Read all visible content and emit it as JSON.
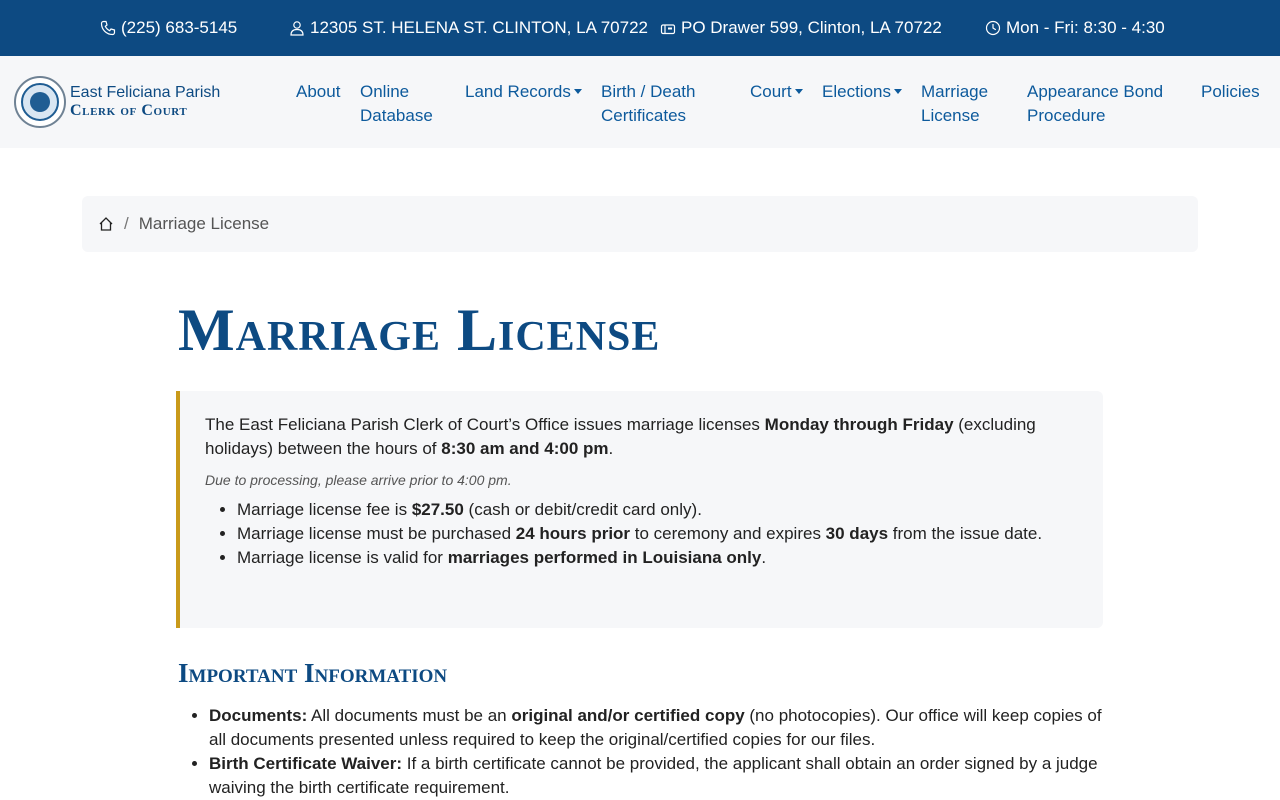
{
  "topbar": {
    "phone": "(225) 683-5145",
    "address": "12305 ST. HELENA ST. CLINTON, LA 70722",
    "mailing": "PO Drawer 599, Clinton, LA 70722",
    "hours": "Mon - Fri: 8:30 - 4:30",
    "colors": {
      "background": "#0d4a82"
    }
  },
  "brand": {
    "line1": "East Feliciana Parish",
    "line2": "Clerk of Court"
  },
  "nav": {
    "about": "About",
    "online_db_1": "Online",
    "online_db_2": "Database",
    "land_records": "Land Records",
    "birth_death_1": "Birth / Death",
    "birth_death_2": "Certificates",
    "court": "Court",
    "elections": "Elections",
    "marriage_1": "Marriage",
    "marriage_2": "License",
    "appearance_1": "Appearance Bond",
    "appearance_2": "Procedure",
    "policies": "Policies"
  },
  "breadcrumb": {
    "home_icon": "home-icon",
    "separator": "/",
    "current": "Marriage License"
  },
  "page": {
    "title": "Marriage License",
    "callout": {
      "intro_1": "The East Feliciana Parish Clerk of Court’s Office issues marriage licenses ",
      "intro_bold_1": "Monday through Friday",
      "intro_2": " (excluding holidays) between the hours of ",
      "intro_bold_2": "8:30 am and 4:00 pm",
      "intro_3": ".",
      "note": "Due to processing, please arrive prior to 4:00 pm.",
      "fee_1": "Marriage license fee is ",
      "fee_bold": "$27.50",
      "fee_2": " (cash or debit/credit card only).",
      "purchase_1": "Marriage license must be purchased ",
      "purchase_bold_1": "24 hours prior",
      "purchase_2": " to ceremony and expires ",
      "purchase_bold_2": "30 days",
      "purchase_3": " from the issue date.",
      "valid_1": "Marriage license is valid for ",
      "valid_bold": "marriages performed in Louisiana only",
      "valid_2": "."
    },
    "important": {
      "title": "Important Information",
      "docs_label": "Documents:",
      "docs_1": " All documents must be an ",
      "docs_bold": "original and/or certified copy",
      "docs_2": " (no photocopies). Our office will keep copies of all documents presented unless required to keep the original/certified copies for our files.",
      "waiver_label": "Birth Certificate Waiver:",
      "waiver_text": " If a birth certificate cannot be provided, the applicant shall obtain an order signed by a judge waiving the birth certificate requirement."
    },
    "colors": {
      "accent": "#c99a1a",
      "heading": "#0d4a82",
      "link": "#0d5a9c"
    }
  }
}
